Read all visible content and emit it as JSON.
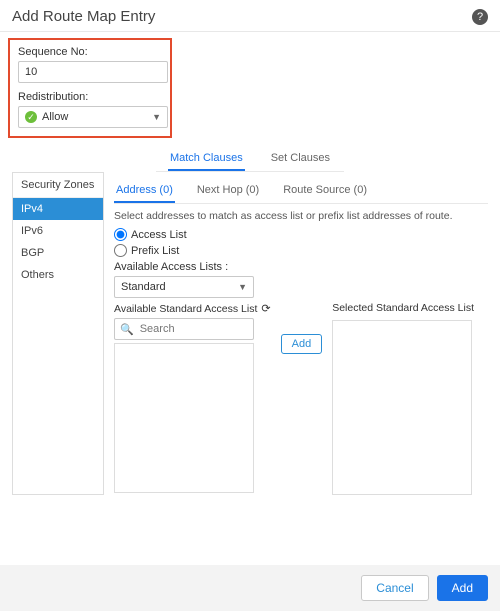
{
  "header": {
    "title": "Add Route Map Entry"
  },
  "fields": {
    "sequence_label": "Sequence No:",
    "sequence_value": "10",
    "redistribution_label": "Redistribution:",
    "redistribution_value": "Allow"
  },
  "tabs": {
    "match": "Match Clauses",
    "set": "Set Clauses"
  },
  "side": {
    "title": "Security Zones",
    "items": [
      "IPv4",
      "IPv6",
      "BGP",
      "Others"
    ]
  },
  "subtabs": {
    "address": "Address (0)",
    "nexthop": "Next Hop (0)",
    "routesource": "Route Source (0)"
  },
  "pane": {
    "hint": "Select addresses to match as access list or prefix list addresses of route.",
    "radio_access": "Access List",
    "radio_prefix": "Prefix List",
    "avail_lists_label": "Available Access Lists :",
    "std_select": "Standard",
    "avail_std_label": "Available Standard Access List",
    "search_placeholder": "Search",
    "add_mini": "Add",
    "selected_std_label": "Selected Standard Access List"
  },
  "footer": {
    "cancel": "Cancel",
    "add": "Add"
  }
}
